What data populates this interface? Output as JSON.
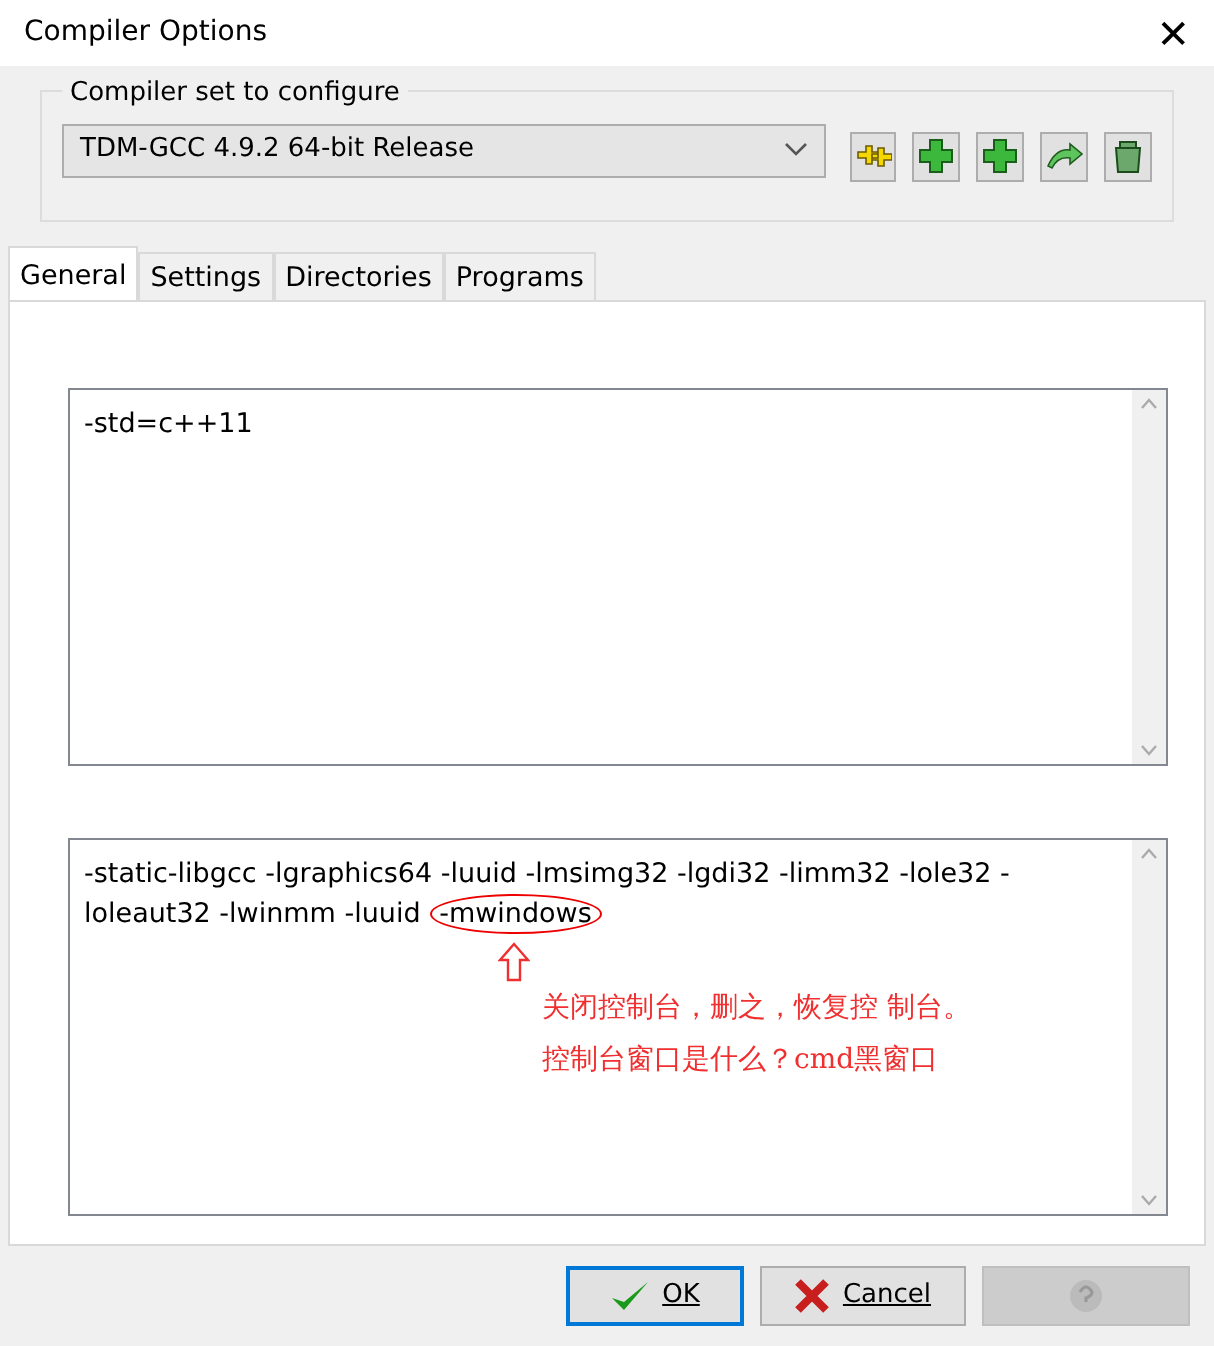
{
  "window": {
    "title": "Compiler Options",
    "close": "✕"
  },
  "compiler_set": {
    "legend": "Compiler set to configure",
    "value": "TDM-GCC 4.9.2 64-bit Release"
  },
  "tabs": [
    {
      "label": "General",
      "selected": true
    },
    {
      "label": "Settings",
      "selected": false
    },
    {
      "label": "Directories",
      "selected": false
    },
    {
      "label": "Programs",
      "selected": false
    }
  ],
  "compiler_commands": {
    "text": "-std=c++11"
  },
  "linker_commands": {
    "text": "-static-libgcc -lgraphics64 -luuid -lmsimg32 -lgdi32 -limm32 -lole32 -loleaut32 -lwinmm -luuid",
    "circled_text": "-mwindows"
  },
  "annotation": {
    "lines": [
      "关闭控制台，删之，恢复控 制台。",
      "控制台窗口是什么？cmd黑窗口"
    ]
  },
  "buttons": [
    {
      "kind": "ok",
      "label": "OK",
      "disabled": false
    },
    {
      "kind": "cancel",
      "label": "Cancel",
      "disabled": false
    },
    {
      "kind": "help",
      "disabled": true
    }
  ]
}
